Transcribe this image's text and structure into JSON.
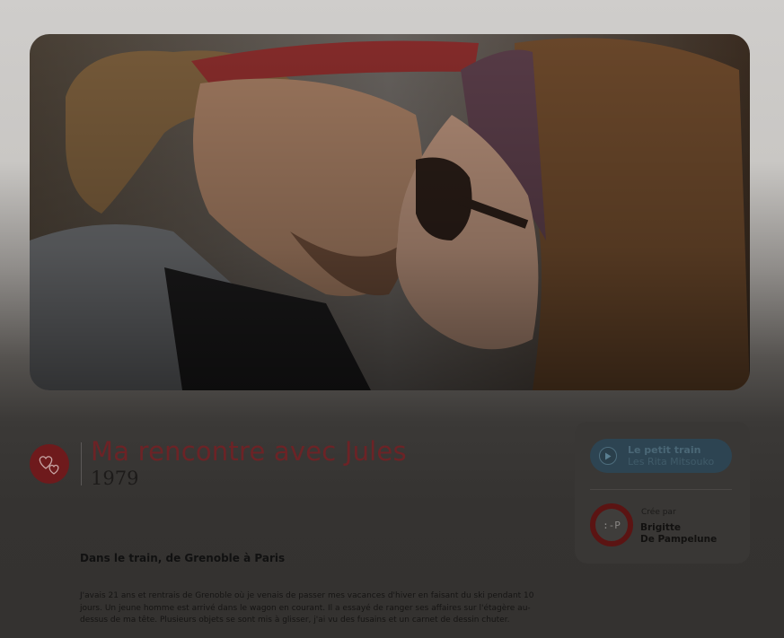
{
  "story": {
    "title": "Ma rencontre avec Jules",
    "year": "1979",
    "subtitle": "Dans le train, de Grenoble à Paris",
    "body": "J'avais 21 ans et rentrais de Grenoble où je venais de passer mes vacances d'hiver en faisant du ski pendant 10 jours. Un jeune homme est arrivé dans le wagon en courant. Il a essayé de ranger ses affaires sur l'étagère au-dessus de ma tête. Plusieurs objets se sont mis à glisser, j'ai vu des fusains et un carnet de dessin chuter."
  },
  "audio": {
    "title": "Le petit train",
    "artist": "Les Rita Mitsouko"
  },
  "creator": {
    "label": "Crée par",
    "avatar_text": ":-P",
    "first_name": "Brigitte",
    "last_name": "De Pampelune"
  },
  "icons": {
    "heart": "hearts-icon",
    "play": "play-icon"
  },
  "colors": {
    "accent": "#6e1a1c",
    "title": "#6c2326",
    "audio_bg": "#2d4452"
  }
}
